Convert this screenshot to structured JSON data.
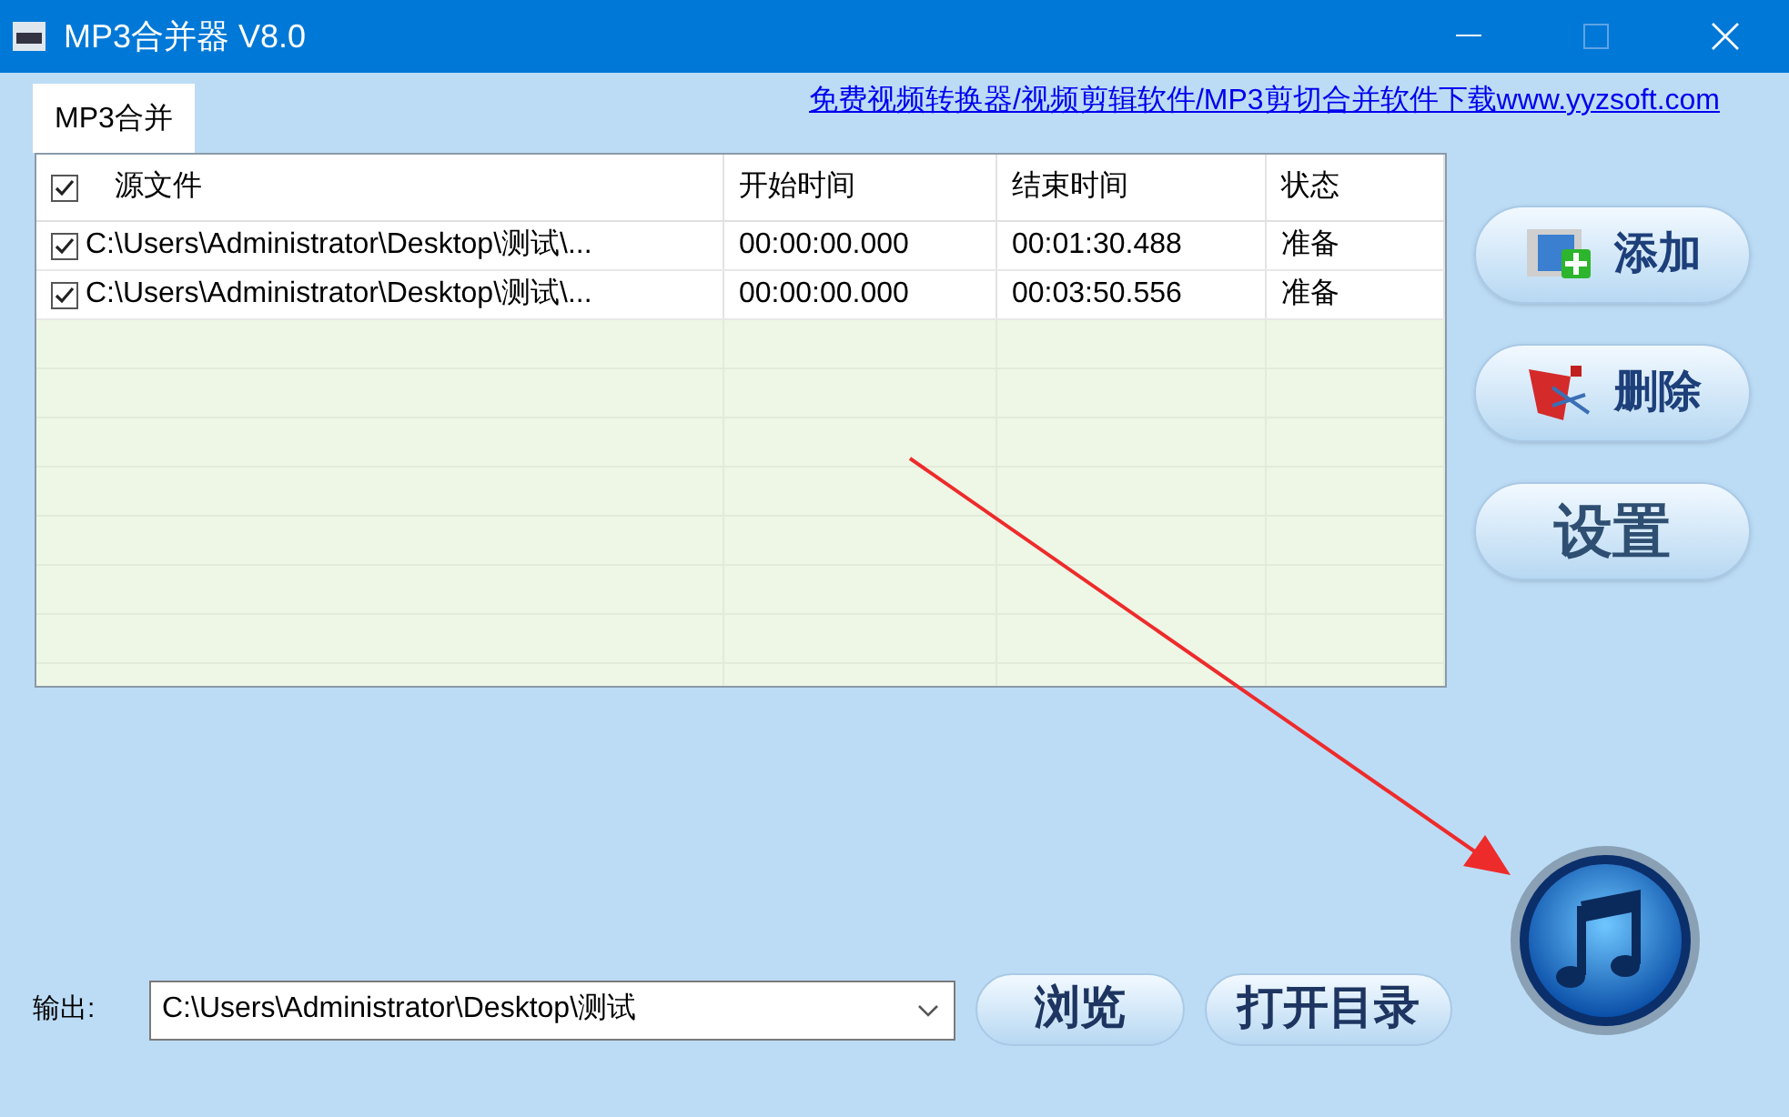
{
  "window": {
    "title": "MP3合并器 V8.0"
  },
  "tabs": [
    {
      "label": "MP3合并",
      "selected": true
    }
  ],
  "link": "免费视频转换器/视频剪辑软件/MP3剪切合并软件下载www.yyzsoft.com",
  "table": {
    "select_all_checked": true,
    "columns": [
      "源文件",
      "开始时间",
      "结束时间",
      "状态"
    ],
    "rows": [
      {
        "checked": true,
        "cells": [
          "C:\\Users\\Administrator\\Desktop\\测试\\...",
          "00:00:00.000",
          "00:01:30.488",
          "准备"
        ]
      },
      {
        "checked": true,
        "cells": [
          "C:\\Users\\Administrator\\Desktop\\测试\\...",
          "00:00:00.000",
          "00:03:50.556",
          "准备"
        ]
      }
    ]
  },
  "side_buttons": [
    {
      "kind": "add",
      "label": "添加"
    },
    {
      "kind": "delete",
      "label": "删除"
    },
    {
      "kind": "settings",
      "label": "设置"
    }
  ],
  "output": {
    "label": "输出:",
    "value": "C:\\Users\\Administrator\\Desktop\\测试",
    "buttons": [
      "浏览",
      "打开目录"
    ]
  }
}
